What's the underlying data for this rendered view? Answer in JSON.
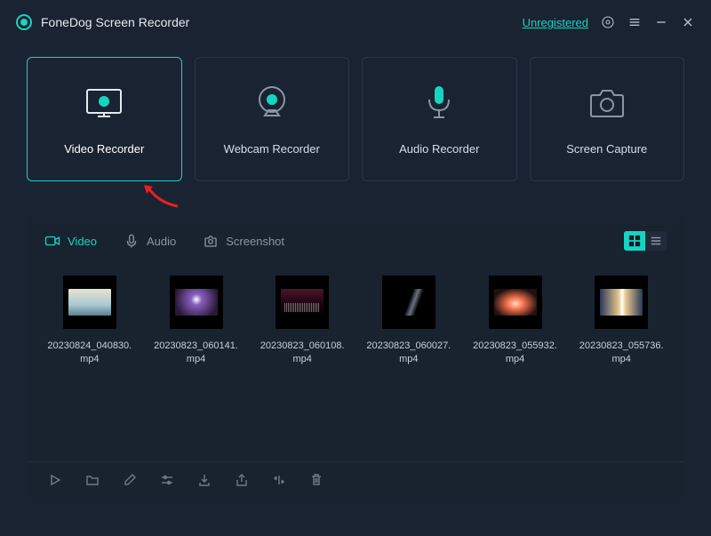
{
  "app": {
    "title": "FoneDog Screen Recorder",
    "registration": "Unregistered"
  },
  "modes": [
    {
      "label": "Video Recorder",
      "active": true
    },
    {
      "label": "Webcam Recorder",
      "active": false
    },
    {
      "label": "Audio Recorder",
      "active": false
    },
    {
      "label": "Screen Capture",
      "active": false
    }
  ],
  "library": {
    "tabs": [
      {
        "label": "Video",
        "active": true
      },
      {
        "label": "Audio",
        "active": false
      },
      {
        "label": "Screenshot",
        "active": false
      }
    ],
    "items": [
      {
        "name": "20230824_040830.mp4"
      },
      {
        "name": "20230823_060141.mp4"
      },
      {
        "name": "20230823_060108.mp4"
      },
      {
        "name": "20230823_060027.mp4"
      },
      {
        "name": "20230823_055932.mp4"
      },
      {
        "name": "20230823_055736.mp4"
      }
    ]
  },
  "colors": {
    "accent": "#15d4c2",
    "bg": "#1a2332",
    "panel": "#19222f"
  }
}
